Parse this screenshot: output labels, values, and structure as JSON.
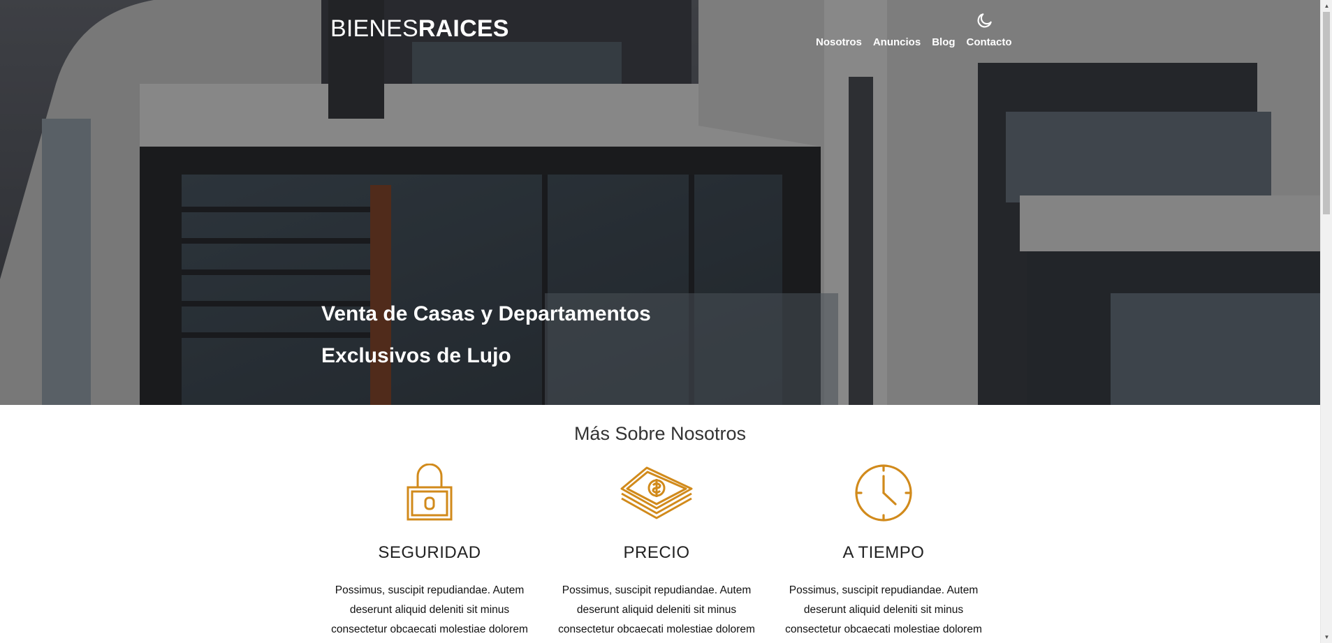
{
  "header": {
    "logo_light": "BIENES",
    "logo_bold": "RAICES",
    "nav": [
      {
        "label": "Nosotros"
      },
      {
        "label": "Anuncios"
      },
      {
        "label": "Blog"
      },
      {
        "label": "Contacto"
      }
    ],
    "theme_toggle_icon": "moon-icon"
  },
  "hero": {
    "title": "Venta de Casas y Departamentos Exclusivos de Lujo"
  },
  "about": {
    "title": "Más Sobre Nosotros",
    "accent_color": "#d18a1b",
    "features": [
      {
        "icon": "lock-icon",
        "title": "SEGURIDAD",
        "text": "Possimus, suscipit repudiandae. Autem deserunt aliquid deleniti sit minus consectetur obcaecati molestiae dolorem"
      },
      {
        "icon": "money-icon",
        "title": "PRECIO",
        "text": "Possimus, suscipit repudiandae. Autem deserunt aliquid deleniti sit minus consectetur obcaecati molestiae dolorem"
      },
      {
        "icon": "clock-icon",
        "title": "A TIEMPO",
        "text": "Possimus, suscipit repudiandae. Autem deserunt aliquid deleniti sit minus consectetur obcaecati molestiae dolorem"
      }
    ]
  }
}
